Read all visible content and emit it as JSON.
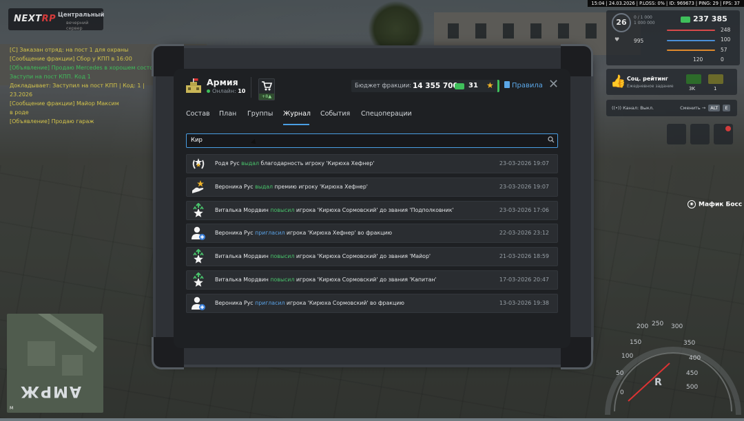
{
  "hud": {
    "logo": {
      "part1": "NEXT",
      "part2": "RP"
    },
    "server": {
      "name": "Центральный",
      "sub": "вечерний сервер"
    },
    "topbar": "15:04 | 24.03.2026 | P.LOSS: 0% | ID: 969673 | PING: 29 | FPS: 37",
    "level": "26",
    "exp_line1": "0 / 1 000",
    "exp_line2": "1 000 000",
    "money": "237 385",
    "stats": {
      "health": "248",
      "armor": "100",
      "hunger": "57",
      "wanted": "0",
      "bonus1": "995",
      "bonus2": "120"
    },
    "social": {
      "title": "Соц. рейтинг",
      "sub": "Ежедневное задание",
      "val1": "3K",
      "val2": "1"
    },
    "voice": {
      "label": "Канал: Выкл.",
      "hint": "Сменить →",
      "key1": "ALT",
      "key2": "E"
    },
    "nameplate": "Мафик Босс",
    "map_letters": "АМРЖ",
    "map_north": "M",
    "speedo": {
      "s0": "0",
      "s50": "50",
      "s100": "100",
      "s150": "150",
      "s200": "200",
      "s250": "250",
      "s300": "300",
      "s350": "350",
      "s400": "400",
      "s450": "450",
      "s500": "500",
      "gear": "R"
    },
    "chat": [
      {
        "text": "[С] Заказан отряд: на пост 1 для охраны",
        "color": "#d4c44a"
      },
      {
        "text": "[Сообщение фракции] Сбор у КПП в 16:00",
        "color": "#d4c44a"
      },
      {
        "text": "[Объявление] Продаю Mercedes в хорошем состоянии",
        "color": "#3fbf5b"
      },
      {
        "text": "Заступи на пост КПП. Код 1",
        "color": "#3fbf5b"
      },
      {
        "text": "Докладывает: Заступил на пост КПП | Код: 1 |",
        "color": "#d4c44a"
      },
      {
        "text": "23.2026",
        "color": "#d4c44a"
      },
      {
        "text": "[Сообщение фракции] Майор Максим",
        "color": "#d4c44a"
      },
      {
        "text": "в роде",
        "color": "#d4c44a"
      },
      {
        "text": "[Объявление] Продаю гараж",
        "color": "#d4c44a"
      }
    ]
  },
  "faction": {
    "name": "Армия",
    "online_label": "Онлайн:",
    "online_count": "10",
    "shop_bonus": "+8▲",
    "budget_label": "Бюджет фракции:",
    "budget_value": "14 355 700",
    "coins": "31",
    "rules": "Правила",
    "close": "✕",
    "tabs": [
      {
        "label": "Состав",
        "active": false
      },
      {
        "label": "План",
        "active": false
      },
      {
        "label": "Группы",
        "active": false
      },
      {
        "label": "Журнал",
        "active": true
      },
      {
        "label": "События",
        "active": false
      },
      {
        "label": "Спецоперации",
        "active": false
      }
    ],
    "search_value": "Кир",
    "log": [
      {
        "icon": "laurel-star-icon",
        "actor": "Родя Рус",
        "action": "выдал",
        "action_type": "green",
        "rest": "благодарность игроку 'Кирюха Хефнер'",
        "date": "23-03-2026 19:07"
      },
      {
        "icon": "hand-star-icon",
        "actor": "Вероника Рус",
        "action": "выдал",
        "action_type": "green",
        "rest": "премию игроку 'Кирюха Хефнер'",
        "date": "23-03-2026 19:07"
      },
      {
        "icon": "star-up-icon",
        "actor": "Виталька Мордвин",
        "action": "повысил",
        "action_type": "green",
        "rest": "игрока 'Кирюха Сормовский' до звания 'Подполковник'",
        "date": "23-03-2026 17:06"
      },
      {
        "icon": "user-plus-icon",
        "actor": "Вероника Рус",
        "action": "пригласил",
        "action_type": "blue",
        "rest": "игрока 'Кирюха Хефнер' во фракцию",
        "date": "22-03-2026 23:12"
      },
      {
        "icon": "star-up-icon",
        "actor": "Виталька Мордвин",
        "action": "повысил",
        "action_type": "green",
        "rest": "игрока 'Кирюха Сормовский' до звания 'Майор'",
        "date": "21-03-2026 18:59"
      },
      {
        "icon": "star-up-icon",
        "actor": "Виталька Мордвин",
        "action": "повысил",
        "action_type": "green",
        "rest": "игрока 'Кирюха Сормовский' до звания 'Капитан'",
        "date": "17-03-2026 20:47"
      },
      {
        "icon": "user-plus-icon",
        "actor": "Вероника Рус",
        "action": "пригласил",
        "action_type": "blue",
        "rest": "игрока 'Кирюха Сормовский' во фракцию",
        "date": "13-03-2026 19:38"
      }
    ]
  }
}
